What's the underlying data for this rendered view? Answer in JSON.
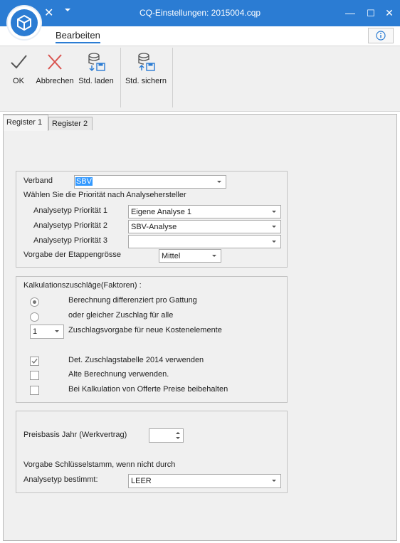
{
  "window": {
    "title": "CQ-Einstellungen: 2015004.cqp",
    "quick_close": "✕",
    "minimize": "—",
    "maximize": "☐",
    "close": "✕"
  },
  "ribbon": {
    "tab_label": "Bearbeiten",
    "buttons": [
      {
        "label": "OK",
        "icon": "checkmark-icon"
      },
      {
        "label": "Abbrechen",
        "icon": "cross-icon"
      },
      {
        "label": "Std. laden",
        "icon": "database-load-icon"
      },
      {
        "label": "Std. sichern",
        "icon": "database-save-icon"
      }
    ]
  },
  "tabs": [
    "Register 1",
    "Register 2"
  ],
  "group1": {
    "verband_label": "Verband",
    "verband_value": "SBV",
    "prioritaet_text": "Wählen Sie die Priorität nach Analysehersteller",
    "prio1_label": "Analysetyp Priorität 1",
    "prio1_value": "Eigene Analyse 1",
    "prio2_label": "Analysetyp Priorität 2",
    "prio2_value": "SBV-Analyse",
    "prio3_label": "Analysetyp Priorität 3",
    "prio3_value": "",
    "etappe_label": "Vorgabe der Etappengrösse",
    "etappe_value": "Mittel"
  },
  "group2": {
    "title": "Kalkulationszuschläge(Faktoren) :",
    "radio1_label": "Berechnung differenziert pro Gattung",
    "radio1_checked": true,
    "radio2_label": "oder gleicher Zuschlag für alle",
    "radio2_checked": false,
    "zuschlag_value": "1",
    "zuschlag_label": "Zuschlagsvorgabe für neue Kostenelemente",
    "chk1_label": "Det. Zuschlagstabelle 2014 verwenden",
    "chk1_checked": true,
    "chk2_label": "Alte Berechnung verwenden.",
    "chk2_checked": false,
    "chk3_label": "Bei Kalkulation von Offerte Preise beibehalten",
    "chk3_checked": false
  },
  "group3": {
    "preisbasis_label": "Preisbasis Jahr (Werkvertrag)",
    "preisbasis_value": "",
    "schluessel_text": "Vorgabe Schlüsselstamm, wenn nicht durch",
    "analysetyp_label": "Analysetyp bestimmt:",
    "analysetyp_value": "LEER"
  },
  "colors": {
    "titlebar": "#2b7cd3",
    "selection": "#3399ff",
    "panel": "#f0f0f0"
  }
}
